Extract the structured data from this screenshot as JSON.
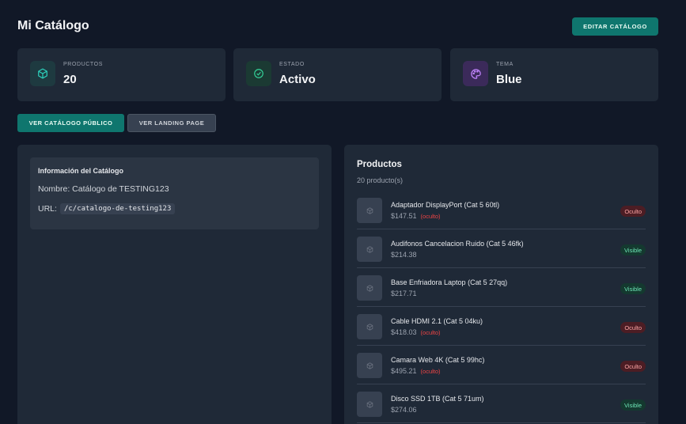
{
  "page": {
    "title": "Mi Catálogo",
    "edit_button": "EDITAR CATÁLOGO"
  },
  "stats": [
    {
      "label": "PRODUCTOS",
      "value": "20",
      "icon": "cube-icon",
      "color": "#2dd4bf",
      "bg": "#1e3a40"
    },
    {
      "label": "ESTADO",
      "value": "Activo",
      "icon": "check-circle-icon",
      "color": "#34d399",
      "bg": "#1b3a33"
    },
    {
      "label": "TEMA",
      "value": "Blue",
      "icon": "palette-icon",
      "color": "#c084fc",
      "bg": "#3b2a5a"
    }
  ],
  "actions": {
    "public_catalog": "VER CATÁLOGO PÚBLICO",
    "landing_page": "VER LANDING PAGE"
  },
  "info": {
    "title": "Información del Catálogo",
    "name_line": "Nombre: Catálogo de TESTING123",
    "url_label": "URL:",
    "url_value": "/c/catalogo-de-testing123"
  },
  "products_panel": {
    "title": "Productos",
    "count": "20 producto(s)",
    "items": [
      {
        "name": "Adaptador DisplayPort (Cat 5 60tl)",
        "price": "$147.51",
        "note": "(oculto)",
        "status": "Oculto",
        "visible": false
      },
      {
        "name": "Audifonos Cancelacion Ruido (Cat 5 46fk)",
        "price": "$214.38",
        "note": "",
        "status": "Visible",
        "visible": true
      },
      {
        "name": "Base Enfriadora Laptop (Cat 5 27qq)",
        "price": "$217.71",
        "note": "",
        "status": "Visible",
        "visible": true
      },
      {
        "name": "Cable HDMI 2.1 (Cat 5 04ku)",
        "price": "$418.03",
        "note": "(oculto)",
        "status": "Oculto",
        "visible": false
      },
      {
        "name": "Camara Web 4K (Cat 5 99hc)",
        "price": "$495.21",
        "note": "(oculto)",
        "status": "Oculto",
        "visible": false
      },
      {
        "name": "Disco SSD 1TB (Cat 5 71um)",
        "price": "$274.06",
        "note": "",
        "status": "Visible",
        "visible": true
      }
    ]
  }
}
